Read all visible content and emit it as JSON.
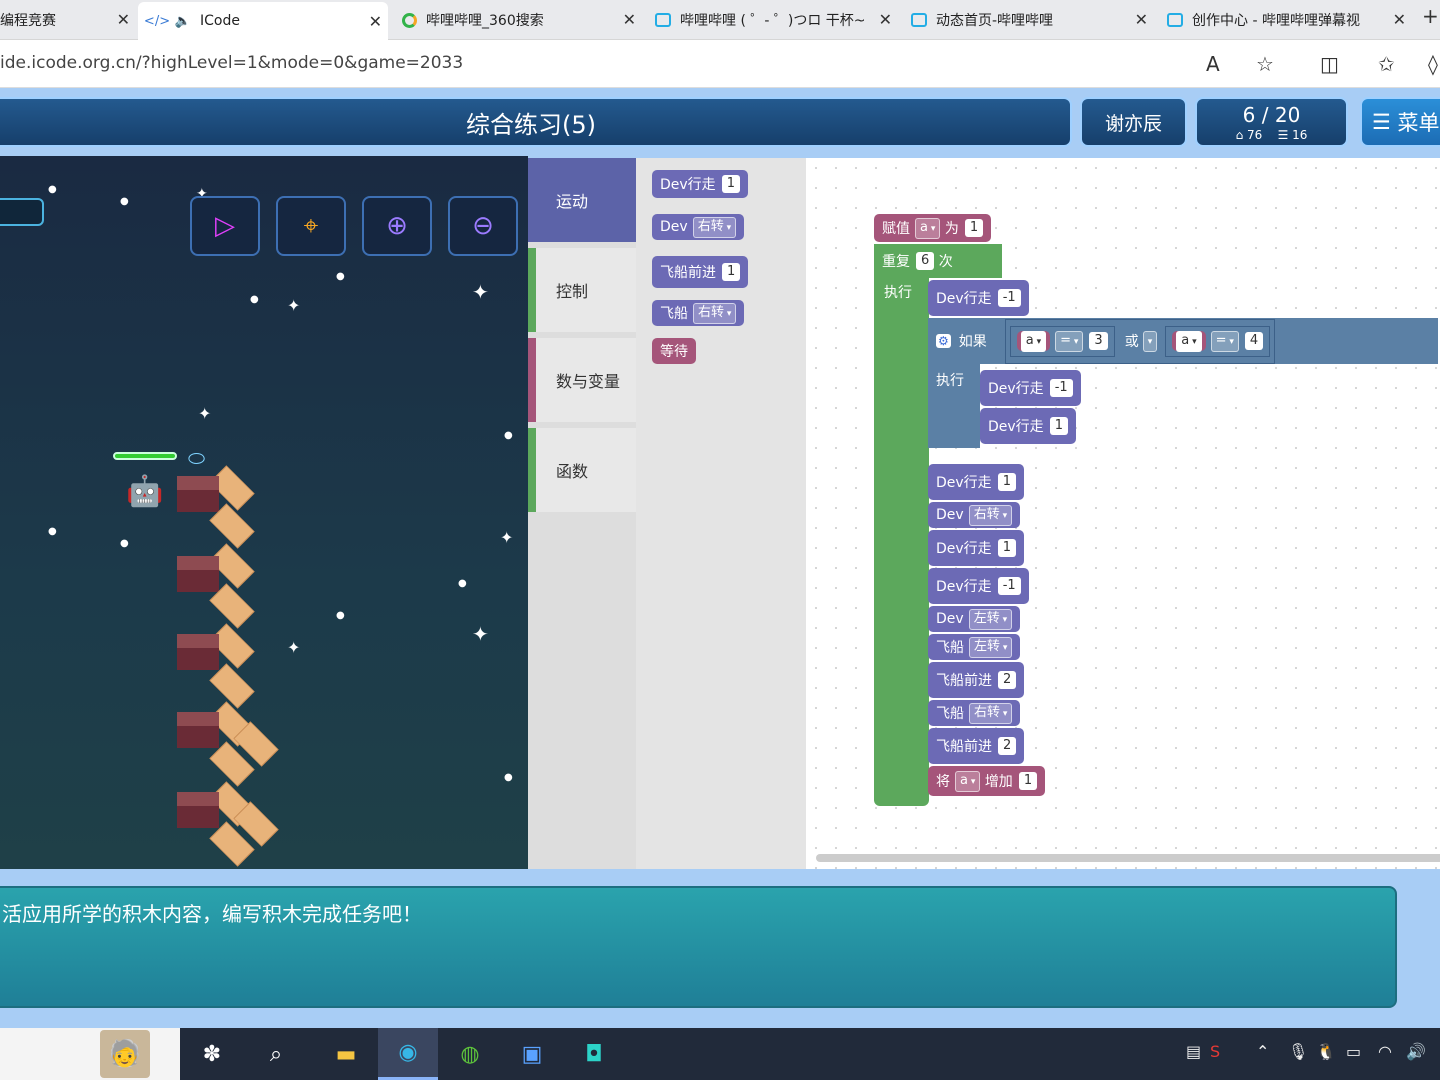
{
  "browser": {
    "tabs": [
      {
        "title": "编程竞赛",
        "icon": "generic-page-icon"
      },
      {
        "title": "ICode",
        "icon": "code-icon",
        "audio": "speaker-icon"
      },
      {
        "title": "哔哩哔哩_360搜索",
        "icon": "search-360-icon"
      },
      {
        "title": "哔哩哔哩 ( ゜- ゜)つロ 干杯~",
        "icon": "bilibili-icon"
      },
      {
        "title": "动态首页-哔哩哔哩",
        "icon": "bilibili-icon"
      },
      {
        "title": "创作中心 - 哔哩哔哩弹幕视",
        "icon": "bilibili-icon"
      }
    ],
    "url": "ide.icode.org.cn/?highLevel=1&mode=0&game=2033"
  },
  "header": {
    "title": "综合练习(5)",
    "user": "谢亦辰",
    "progress": "6 / 20",
    "stat1": "76",
    "stat2": "16",
    "menu": "菜单"
  },
  "categories": [
    "运动",
    "控制",
    "数与变量",
    "函数"
  ],
  "flyout": [
    {
      "label": "Dev行走",
      "value": "1"
    },
    {
      "label": "Dev",
      "dropdown": "右转"
    },
    {
      "label": "飞船前进",
      "value": "1"
    },
    {
      "label": "飞船",
      "dropdown": "右转"
    },
    {
      "label": "等待"
    }
  ],
  "program": {
    "assign": {
      "label": "赋值",
      "var": "a",
      "mid": "为",
      "value": "1"
    },
    "repeat": {
      "label": "重复",
      "count": "6",
      "suffix": "次",
      "exec": "执行"
    },
    "b1": {
      "label": "Dev行走",
      "value": "-1"
    },
    "if": {
      "label": "如果",
      "exec": "执行",
      "var1": "a",
      "op1": "=",
      "val1": "3",
      "or": "或",
      "var2": "a",
      "op2": "=",
      "val2": "4"
    },
    "if_b1": {
      "label": "Dev行走",
      "value": "-1"
    },
    "if_b2": {
      "label": "Dev行走",
      "value": "1"
    },
    "b2": {
      "label": "Dev行走",
      "value": "1"
    },
    "b3": {
      "label": "Dev",
      "dropdown": "右转"
    },
    "b4": {
      "label": "Dev行走",
      "value": "1"
    },
    "b5": {
      "label": "Dev行走",
      "value": "-1"
    },
    "b6": {
      "label": "Dev",
      "dropdown": "左转"
    },
    "b7": {
      "label": "飞船",
      "dropdown": "左转"
    },
    "b8": {
      "label": "飞船前进",
      "value": "2"
    },
    "b9": {
      "label": "飞船",
      "dropdown": "右转"
    },
    "b10": {
      "label": "飞船前进",
      "value": "2"
    },
    "inc": {
      "label": "将",
      "var": "a",
      "mid": "增加",
      "value": "1"
    }
  },
  "instruction": "活应用所学的积木内容，编写积木完成任务吧！"
}
